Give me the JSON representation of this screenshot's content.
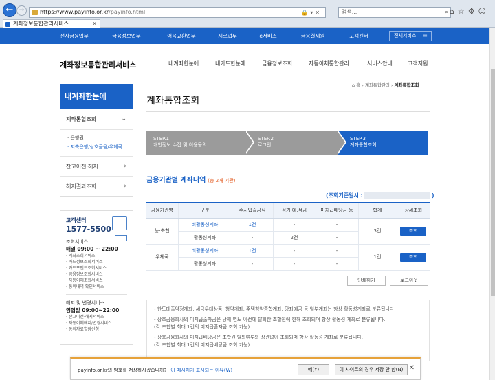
{
  "browser": {
    "url_main": "https://www.payinfo.or.kr",
    "url_path": "/payinfo.html",
    "search_placeholder": "검색...",
    "tab_title": "계좌정보통합관리서비스"
  },
  "topnav": [
    "전자금융업무",
    "금융정보업무",
    "어음교환업무",
    "지로업무",
    "e서비스",
    "금융결제원",
    "고객센터"
  ],
  "topnav_all": "전체서비스",
  "header": {
    "logo": "계좌정보통합관리서비스",
    "menu": [
      "내계좌한눈에",
      "내카드한눈에",
      "금융정보조회",
      "자동이체통합관리",
      "서비스안내",
      "고객지원"
    ]
  },
  "sidebar": {
    "title": "내계좌한눈에",
    "items": [
      {
        "label": "계좌통합조회"
      },
      {
        "label": "잔고이전·해지"
      },
      {
        "label": "해지결과조회"
      }
    ],
    "sub": [
      "· 은행권",
      "· 저축은행/상호금융/우체국"
    ]
  },
  "customer_center": {
    "label": "고객센터",
    "tel": "1577-5500",
    "svc_title": "조회서비스",
    "svc_hours": "매일 09:00 ~ 22:00",
    "svc_list": [
      "· 계좌조회서비스",
      "· 카드정보조회서비스",
      "· 카드포인트조회서비스",
      "· 금융정보조회서비스",
      "· 자동이체조회서비스",
      "· 동의내역 확인서비스"
    ],
    "chg_title": "해지 및 변경서비스",
    "chg_hours": "영업일 09:00~22:00",
    "chg_list": [
      "· 잔고이전·해지서비스",
      "· 자동이체해지/변경서비스",
      "· 동의자료열람신청"
    ]
  },
  "breadcrumb": {
    "home": "홈",
    "mid": "계좌통합관리",
    "current": "계좌통합조회"
  },
  "page_title": "계좌통합조회",
  "steps": [
    {
      "num": "STEP.1",
      "label": "개인정보 수집 및 이용동의"
    },
    {
      "num": "STEP.2",
      "label": "로그인"
    },
    {
      "num": "STEP.3",
      "label": "계좌통합조회"
    }
  ],
  "section": {
    "title": "금융기관별 계좌내역",
    "count": "(총 2개 기관)"
  },
  "query_date": {
    "prefix": "(조회기준일시 :",
    "suffix": ")"
  },
  "table": {
    "headers": [
      "금융기관명",
      "구분",
      "수시입출금식",
      "정기 예,적금",
      "미지급배당금 등",
      "합계",
      "상세조회"
    ],
    "groups": [
      {
        "name": "농·축협",
        "total": "3건",
        "view": "조회",
        "rows": [
          [
            "비활동성계좌",
            "1건",
            "-",
            "-"
          ],
          [
            "활동성계좌",
            "-",
            "2건",
            "-"
          ]
        ]
      },
      {
        "name": "우체국",
        "total": "1건",
        "view": "조회",
        "rows": [
          [
            "비활동성계좌",
            "1건",
            "-",
            "-"
          ],
          [
            "활동성계좌",
            "-",
            "-",
            "-"
          ]
        ]
      }
    ]
  },
  "buttons": {
    "print": "인쇄하기",
    "logout": "로그아웃"
  },
  "notice": [
    "- 한도대출약정계좌, 세금우대상품, 청약계좌, 주택청약종합계좌, 당좌예금 등 일부계좌는 항상 활동성계좌로 분류됩니다.",
    "- 상호금융회사의 미지급출자금은 당해 연도 이전에 탈퇴한 조합원에 한해 조회되며 항상 활동성 계좌로 분류됩니다.",
    "  (각 조합별 최대 1건의 미지급출자금 조회 가능)",
    "- 상호금융회사의 미지급배당금은 조합원 탈퇴여부와 상관없이 조회되며 항상 활동성 계좌로 분류됩니다.",
    "  (각 조합별 최대 1건의 미지급배당금 조회 가능)"
  ],
  "pwbar": {
    "question": "payinfo.or.kr의 암호를 저장하시겠습니까?",
    "why": "이 메시지가 표시되는 이유(W)",
    "yes": "예(Y)",
    "never": "이 사이트의 경우 저장 안 함(N)",
    "close": "✕"
  }
}
